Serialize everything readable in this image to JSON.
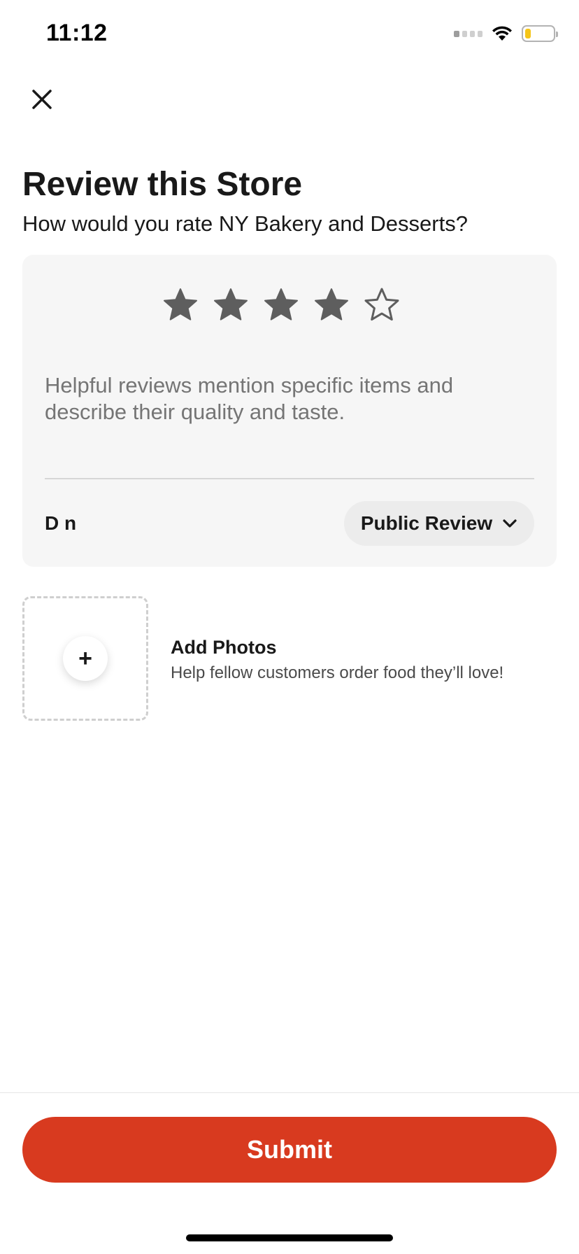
{
  "status_bar": {
    "time": "11:12",
    "battery_level": 0.2,
    "battery_color": "#f5c518"
  },
  "header": {
    "close_icon": "close-icon",
    "title": "Review this Store",
    "subtitle": "How would you rate NY Bakery and Desserts?"
  },
  "review": {
    "rating": 4,
    "max_rating": 5,
    "placeholder": "Helpful reviews mention specific items and describe their quality and taste.",
    "author": "D n",
    "visibility_label": "Public Review"
  },
  "photos": {
    "title": "Add Photos",
    "subtitle": "Help fellow customers order food they’ll love!",
    "add_symbol": "+"
  },
  "footer": {
    "submit_label": "Submit",
    "accent_color": "#d83a1f"
  }
}
